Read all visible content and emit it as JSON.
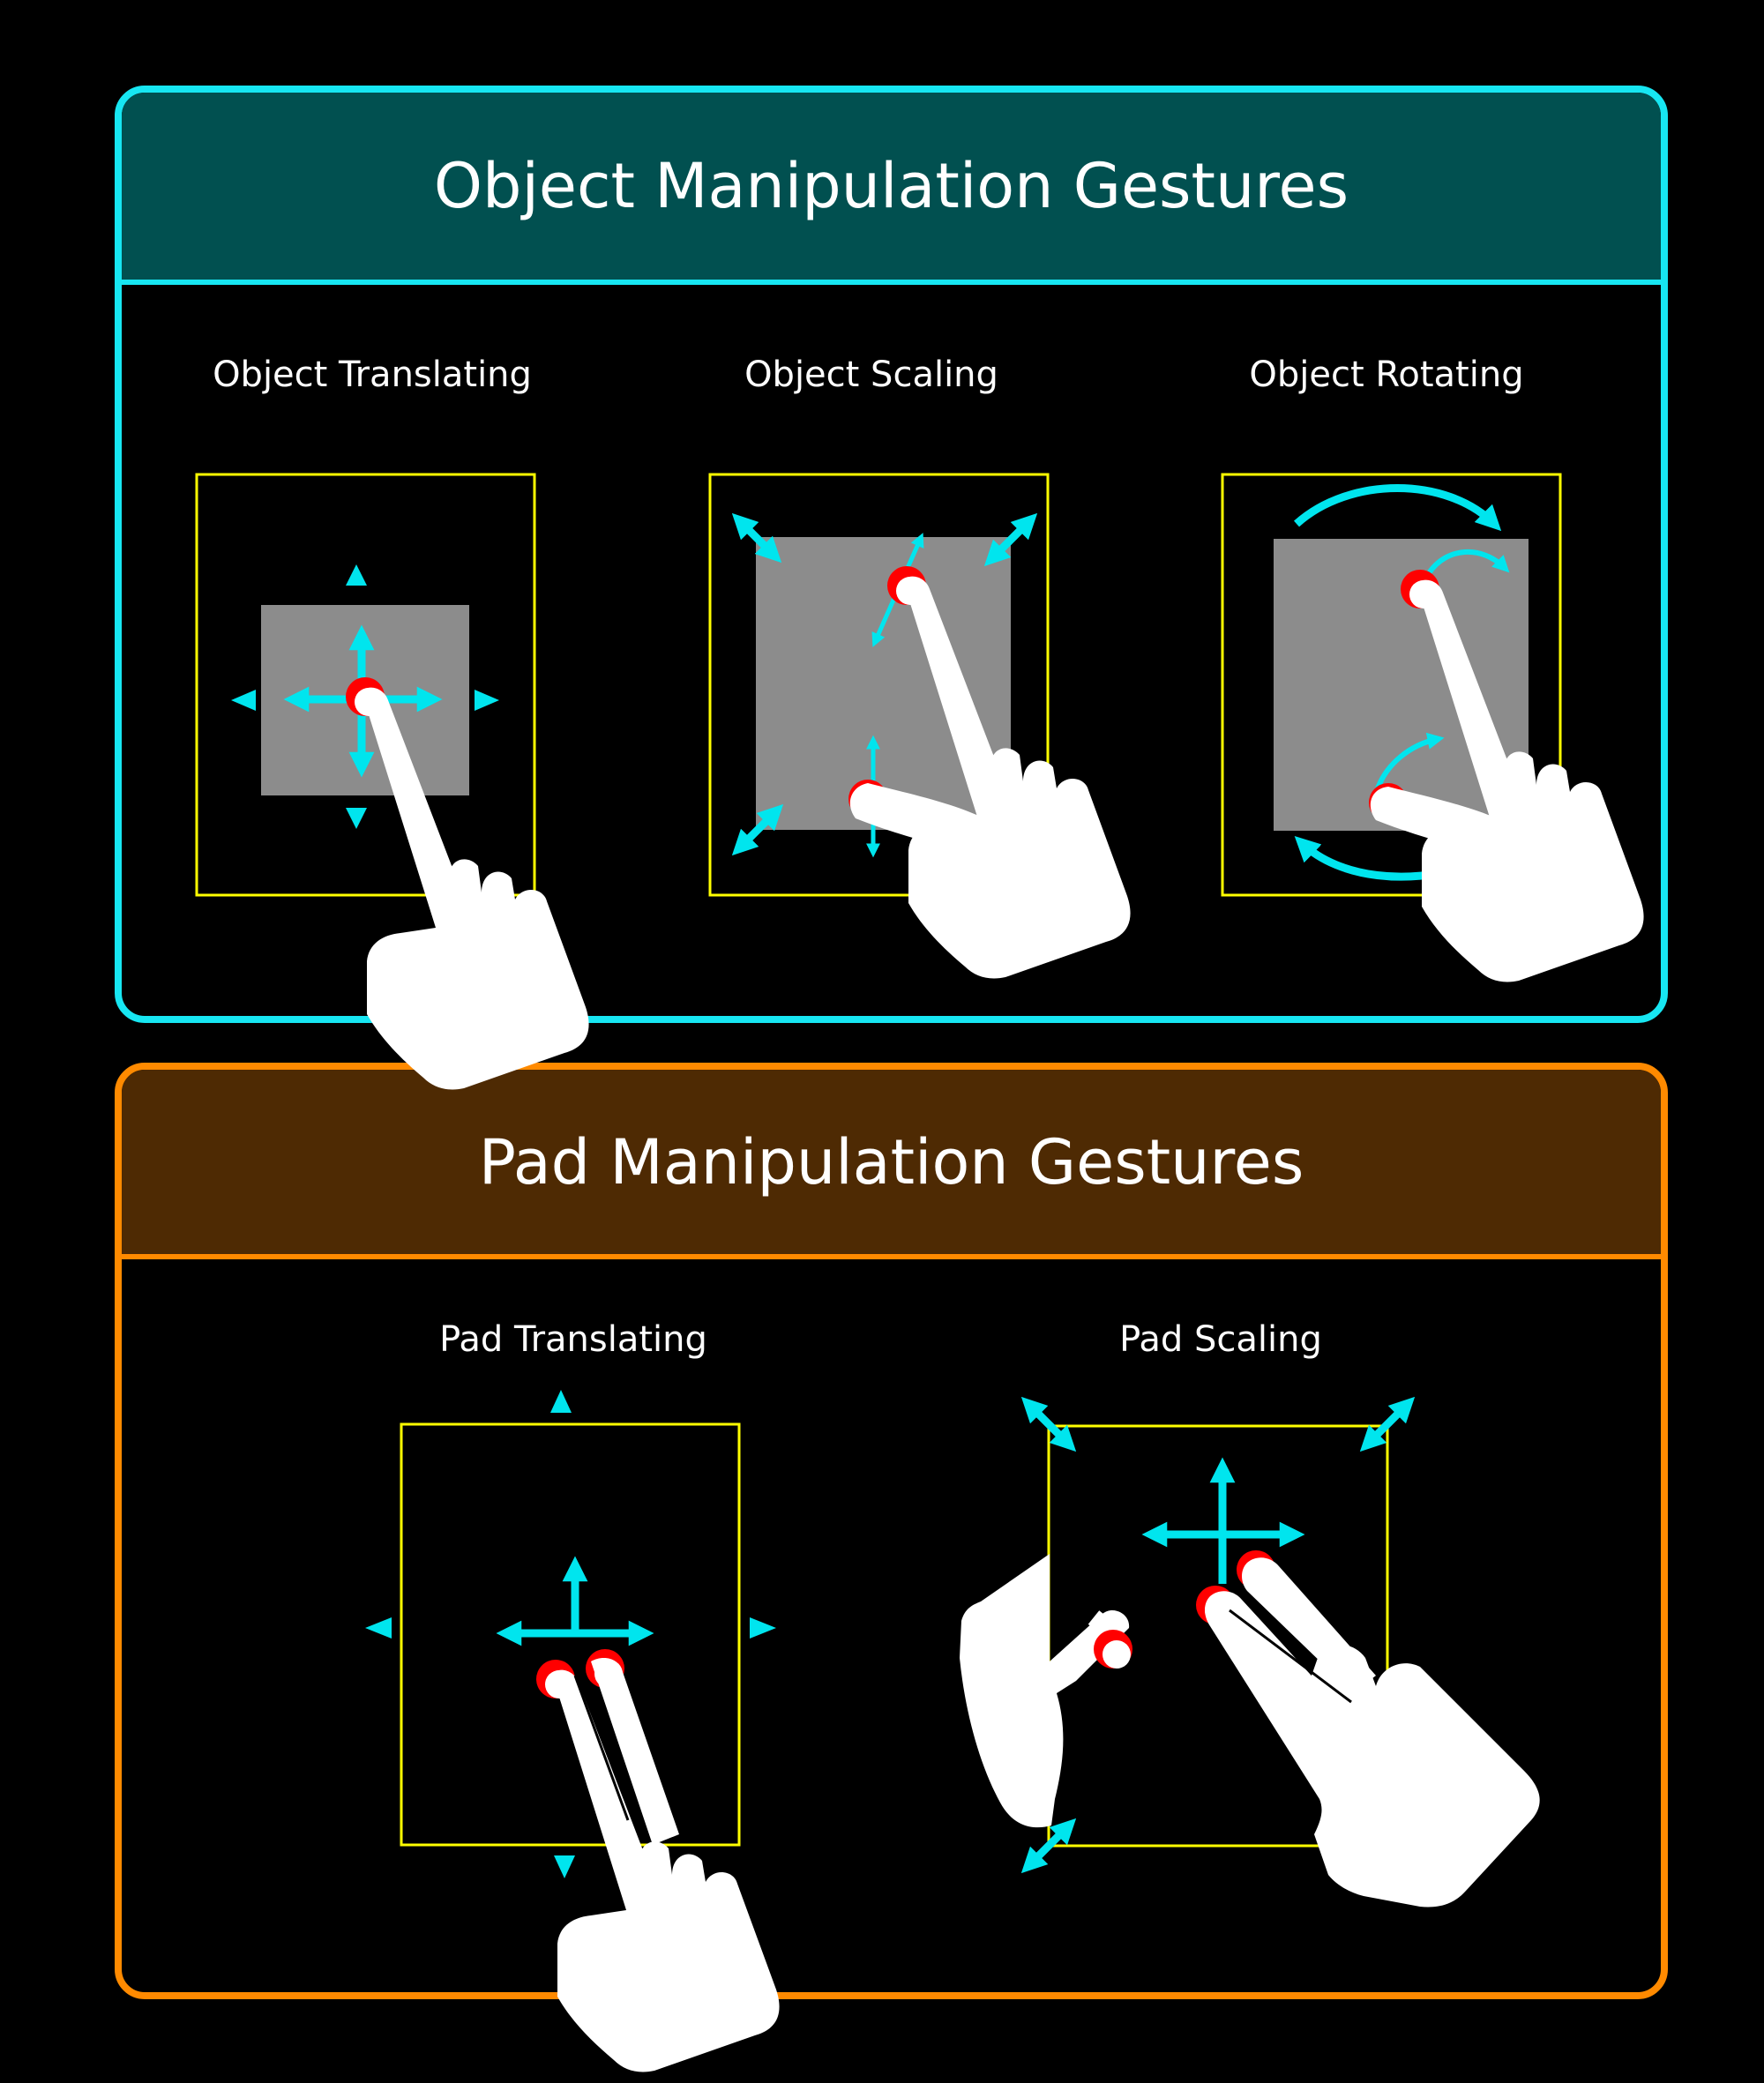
{
  "object_panel": {
    "title": "Object Manipulation Gestures",
    "gestures": {
      "translating": "Object Translating",
      "scaling": "Object Scaling",
      "rotating": "Object Rotating"
    }
  },
  "pad_panel": {
    "title": "Pad Manipulation Gestures",
    "gestures": {
      "translating": "Pad Translating",
      "scaling": "Pad Scaling"
    }
  },
  "colors": {
    "object_accent": "#17e6f2",
    "object_header": "#015050",
    "pad_accent": "#ff8a00",
    "pad_header": "#4e2a03",
    "frame": "#ffff00",
    "object_fill": "#8c8c8c",
    "arrow": "#00e5ee",
    "touch": "#ff0000",
    "hand": "#ffffff"
  },
  "icons": [
    "hand-pointer-icon",
    "two-finger-hand-icon",
    "open-hand-icon",
    "move-arrows-icon",
    "resize-arrows-icon",
    "rotate-arrows-icon"
  ]
}
